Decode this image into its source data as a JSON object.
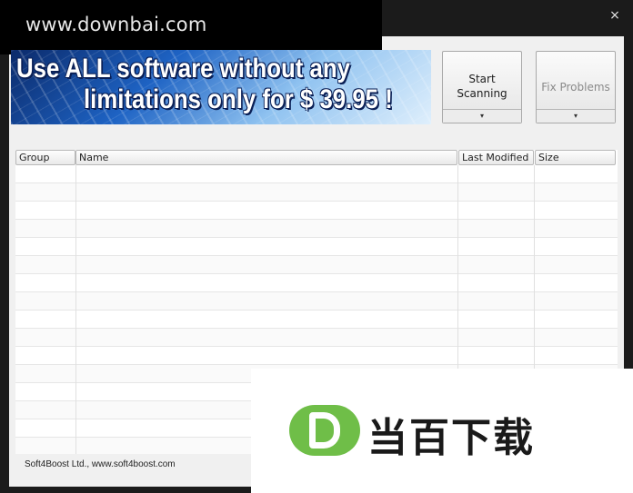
{
  "watermark_top": {
    "text": "www.downbai.com"
  },
  "window": {
    "close_label": "×"
  },
  "banner": {
    "line1": "Use ALL software without any",
    "line2": "limitations only for $ 39.95 !"
  },
  "toolbar": {
    "start_label": "Start\nScanning",
    "fix_label": "Fix Problems",
    "dropdown_glyph": "▾"
  },
  "table": {
    "columns": [
      "Group",
      "Name",
      "Last Modified",
      "Size"
    ],
    "rows": []
  },
  "footer": {
    "text": "Soft4Boost Ltd., www.soft4boost.com"
  },
  "watermark_overlay": {
    "text": "当百下载"
  },
  "colors": {
    "window_frame": "#1b1b1b",
    "client_bg": "#f0f0f0",
    "logo_green": "#6fbe48"
  }
}
